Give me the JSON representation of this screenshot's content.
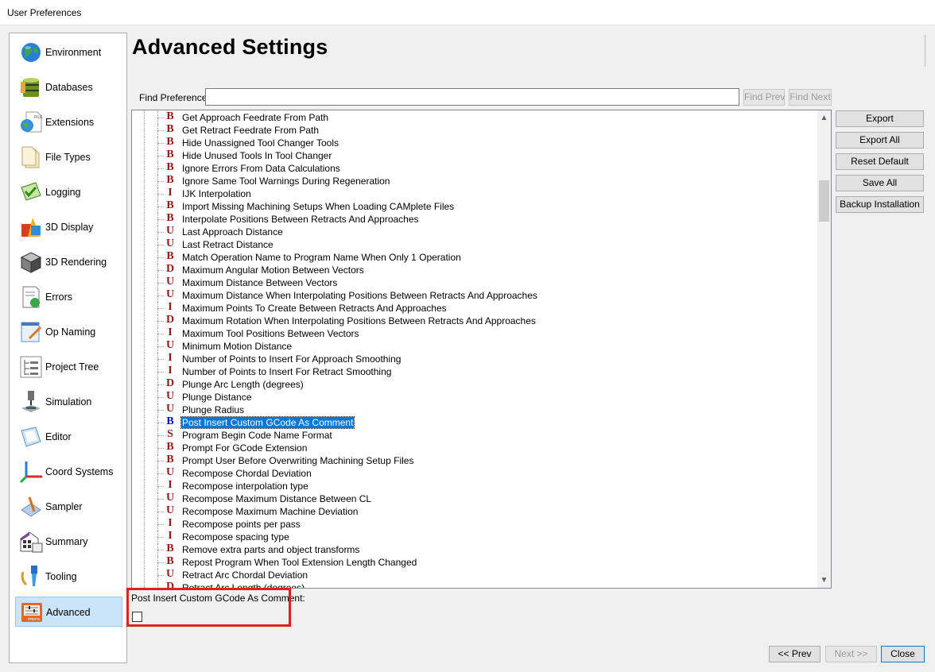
{
  "window": {
    "title": "User Preferences"
  },
  "sidebar": {
    "items": [
      {
        "label": "Environment",
        "icon": "globe-icon"
      },
      {
        "label": "Databases",
        "icon": "database-icon"
      },
      {
        "label": "Extensions",
        "icon": "file-globe-icon"
      },
      {
        "label": "File Types",
        "icon": "document-icon"
      },
      {
        "label": "Logging",
        "icon": "log-icon"
      },
      {
        "label": "3D Display",
        "icon": "shapes-icon"
      },
      {
        "label": "3D Rendering",
        "icon": "cube-icon"
      },
      {
        "label": "Errors",
        "icon": "errors-icon"
      },
      {
        "label": "Op Naming",
        "icon": "op-naming-icon"
      },
      {
        "label": "Project Tree",
        "icon": "tree-icon"
      },
      {
        "label": "Simulation",
        "icon": "simulation-icon"
      },
      {
        "label": "Editor",
        "icon": "editor-icon"
      },
      {
        "label": "Coord Systems",
        "icon": "axes-icon"
      },
      {
        "label": "Sampler",
        "icon": "sampler-icon"
      },
      {
        "label": "Summary",
        "icon": "summary-icon"
      },
      {
        "label": "Tooling",
        "icon": "tooling-icon"
      },
      {
        "label": "Advanced",
        "icon": "prefs-icon"
      }
    ],
    "selected": "Advanced"
  },
  "main": {
    "title": "Advanced Settings",
    "find": {
      "label": "Find Preference",
      "value": "",
      "prev_label": "Find Prev",
      "next_label": "Find Next"
    },
    "side_buttons": [
      "Export",
      "Export All",
      "Reset Default",
      "Save All",
      "Backup Installation"
    ],
    "tree_rows": [
      {
        "type": "B",
        "label": "Get Approach Feedrate From Path"
      },
      {
        "type": "B",
        "label": "Get Retract Feedrate From Path"
      },
      {
        "type": "B",
        "label": "Hide Unassigned Tool Changer Tools"
      },
      {
        "type": "B",
        "label": "Hide Unused Tools In Tool Changer"
      },
      {
        "type": "B",
        "label": "Ignore Errors From Data Calculations"
      },
      {
        "type": "B",
        "label": "Ignore Same Tool Warnings During Regeneration"
      },
      {
        "type": "I",
        "label": "IJK Interpolation"
      },
      {
        "type": "B",
        "label": "Import Missing Machining Setups When Loading CAMplete Files"
      },
      {
        "type": "B",
        "label": "Interpolate Positions Between Retracts And Approaches"
      },
      {
        "type": "U",
        "label": "Last Approach Distance"
      },
      {
        "type": "U",
        "label": "Last Retract Distance"
      },
      {
        "type": "B",
        "label": "Match Operation Name to Program Name When Only 1 Operation"
      },
      {
        "type": "D",
        "label": "Maximum Angular Motion Between Vectors"
      },
      {
        "type": "U",
        "label": "Maximum Distance Between Vectors"
      },
      {
        "type": "U",
        "label": "Maximum Distance When Interpolating Positions Between Retracts And Approaches"
      },
      {
        "type": "I",
        "label": "Maximum Points To Create Between Retracts And Approaches"
      },
      {
        "type": "D",
        "label": "Maximum Rotation When Interpolating Positions Between Retracts And Approaches"
      },
      {
        "type": "I",
        "label": "Maximum Tool Positions Between Vectors"
      },
      {
        "type": "U",
        "label": "Minimum Motion Distance"
      },
      {
        "type": "I",
        "label": "Number of Points to Insert For Approach Smoothing"
      },
      {
        "type": "I",
        "label": "Number of Points to Insert For Retract Smoothing"
      },
      {
        "type": "D",
        "label": "Plunge Arc Length (degrees)"
      },
      {
        "type": "U",
        "label": "Plunge Distance"
      },
      {
        "type": "U",
        "label": "Plunge Radius"
      },
      {
        "type": "B",
        "label": "Post Insert Custom GCode As Comment",
        "selected": true
      },
      {
        "type": "S",
        "label": "Program Begin Code Name Format"
      },
      {
        "type": "B",
        "label": "Prompt For GCode Extension"
      },
      {
        "type": "B",
        "label": "Prompt User Before Overwriting Machining Setup Files"
      },
      {
        "type": "U",
        "label": "Recompose Chordal Deviation"
      },
      {
        "type": "I",
        "label": "Recompose interpolation type"
      },
      {
        "type": "U",
        "label": "Recompose Maximum Distance Between CL"
      },
      {
        "type": "U",
        "label": "Recompose Maximum Machine Deviation"
      },
      {
        "type": "I",
        "label": "Recompose points per pass"
      },
      {
        "type": "I",
        "label": "Recompose spacing type"
      },
      {
        "type": "B",
        "label": "Remove extra parts and object transforms"
      },
      {
        "type": "B",
        "label": "Repost Program When Tool Extension Length Changed"
      },
      {
        "type": "U",
        "label": "Retract Arc Chordal Deviation"
      },
      {
        "type": "D",
        "label": "Retract Arc Length (degrees)"
      }
    ],
    "detail": {
      "label": "Post Insert Custom GCode As Comment:",
      "checked": false
    }
  },
  "footer": {
    "prev_label": "<< Prev",
    "next_label": "Next >>",
    "close_label": "Close"
  },
  "colors": {
    "selection": "#0078d7",
    "highlight": "#e02020",
    "sidebar_selected": "#cce4f7"
  }
}
